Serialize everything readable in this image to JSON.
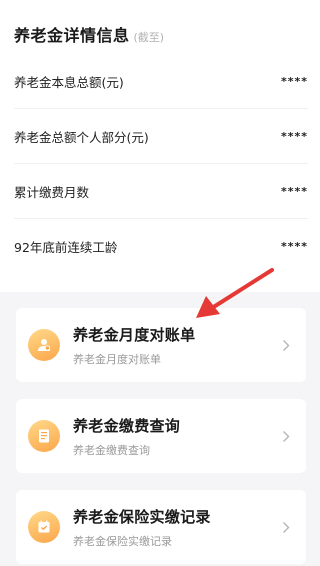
{
  "header": {
    "title": "养老金详情信息",
    "subtitle": "(截至)"
  },
  "details": [
    {
      "label": "养老金本息总额(元)",
      "value": "****"
    },
    {
      "label": "养老金总额个人部分(元)",
      "value": "****"
    },
    {
      "label": "累计缴费月数",
      "value": "****"
    },
    {
      "label": "92年底前连续工龄",
      "value": "****"
    }
  ],
  "services": [
    {
      "title": "养老金月度对账单",
      "subtitle": "养老金月度对账单",
      "icon": "statement-icon"
    },
    {
      "title": "养老金缴费查询",
      "subtitle": "养老金缴费查询",
      "icon": "document-icon"
    },
    {
      "title": "养老金保险实缴记录",
      "subtitle": "养老金保险实缴记录",
      "icon": "calendar-icon"
    }
  ],
  "annotation": {
    "icon": "red-arrow-icon",
    "color": "#e53935"
  },
  "colors": {
    "icon_gradient_start": "#ffd98a",
    "icon_gradient_end": "#fba64a",
    "background_gray": "#f5f5f7"
  }
}
